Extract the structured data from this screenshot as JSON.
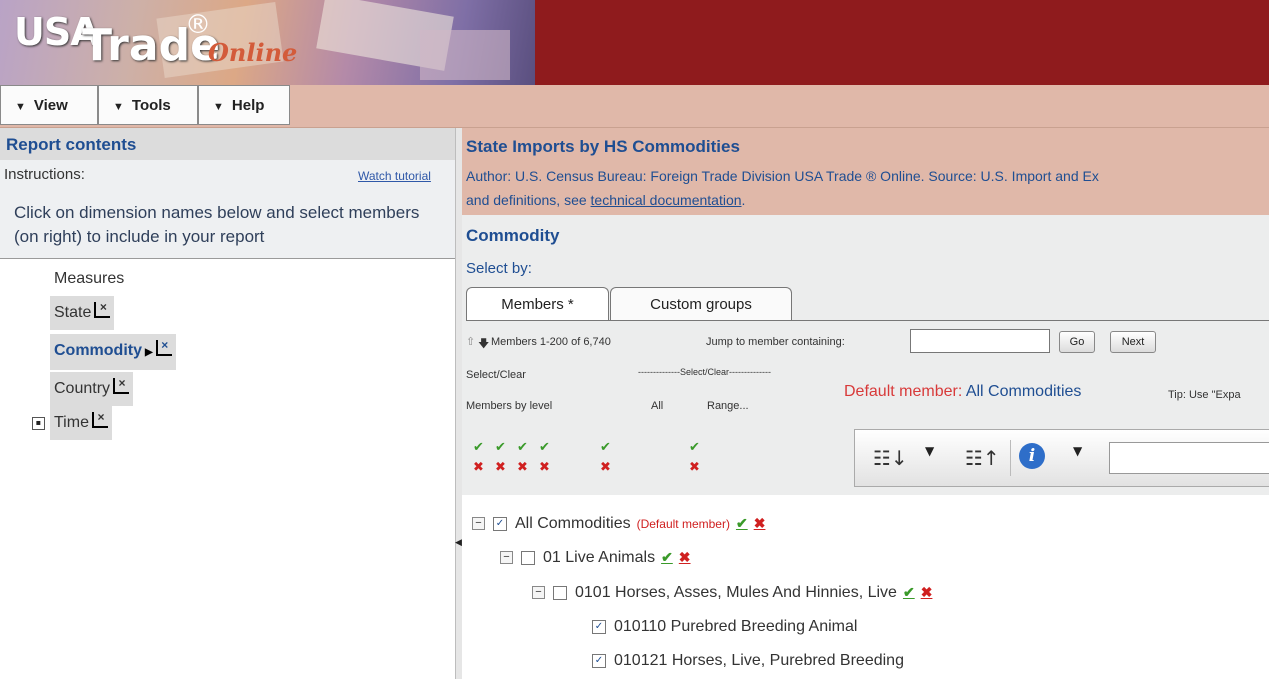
{
  "header": {
    "logo_usa": "USA",
    "logo_trade": "Trade",
    "logo_reg": "®",
    "logo_online": "Online",
    "background_color": "#8f1b1d"
  },
  "menubar": {
    "items": [
      {
        "label": "View",
        "icon": "triangle-down-icon"
      },
      {
        "label": "Tools",
        "icon": "triangle-down-icon"
      },
      {
        "label": "Help",
        "icon": "triangle-down-icon"
      }
    ]
  },
  "left_panel": {
    "title": "Report contents",
    "instructions_label": "Instructions:",
    "tutorial_link": "Watch tutorial",
    "instructions_text": "Click on dimension names below and select members (on right) to include in your report",
    "dimensions": [
      {
        "label": "Measures"
      },
      {
        "label": "State"
      },
      {
        "label": "Commodity"
      },
      {
        "label": "Country"
      },
      {
        "label": "Time"
      }
    ]
  },
  "right_panel": {
    "report_title": "State Imports by HS Commodities",
    "author_text": "Author: U.S. Census Bureau: Foreign Trade Division USA Trade ® Online. Source: U.S. Import and Ex",
    "definitions_prefix": "and definitions, see ",
    "definitions_link": "technical documentation",
    "definitions_suffix": ".",
    "section_title": "Commodity",
    "select_by": "Select by:",
    "tabs": [
      {
        "label": "Members *"
      },
      {
        "label": "Custom groups"
      }
    ],
    "members_range": "Members 1-200 of 6,740",
    "jump_label": "Jump to member containing:",
    "go_button": "Go",
    "next_button": "Next",
    "select_clear": "Select/Clear",
    "select_clear_dashed": "--------------Select/Clear--------------",
    "members_by_level": "Members by level",
    "all_label": "All",
    "range_label": "Range...",
    "default_member_label": "Default member: ",
    "default_member_value": "All Commodities",
    "tip_text": "Tip: Use \"Expa",
    "tree": [
      {
        "label": "All Commodities",
        "tag": "(Default member)",
        "checked": true
      },
      {
        "label": "01 Live Animals",
        "checked": false
      },
      {
        "label": "0101 Horses, Asses, Mules And Hinnies, Live",
        "checked": false
      },
      {
        "label": "010110 Purebred Breeding Animal",
        "checked": true
      },
      {
        "label": "010121 Horses, Live, Purebred Breeding",
        "checked": true
      }
    ]
  },
  "colors": {
    "accent_blue": "#1f4e92",
    "menubar_bg": "#e0b8a9",
    "default_red": "#d83a3a",
    "select_green": "#3a9a2a",
    "clear_red": "#d02020"
  }
}
